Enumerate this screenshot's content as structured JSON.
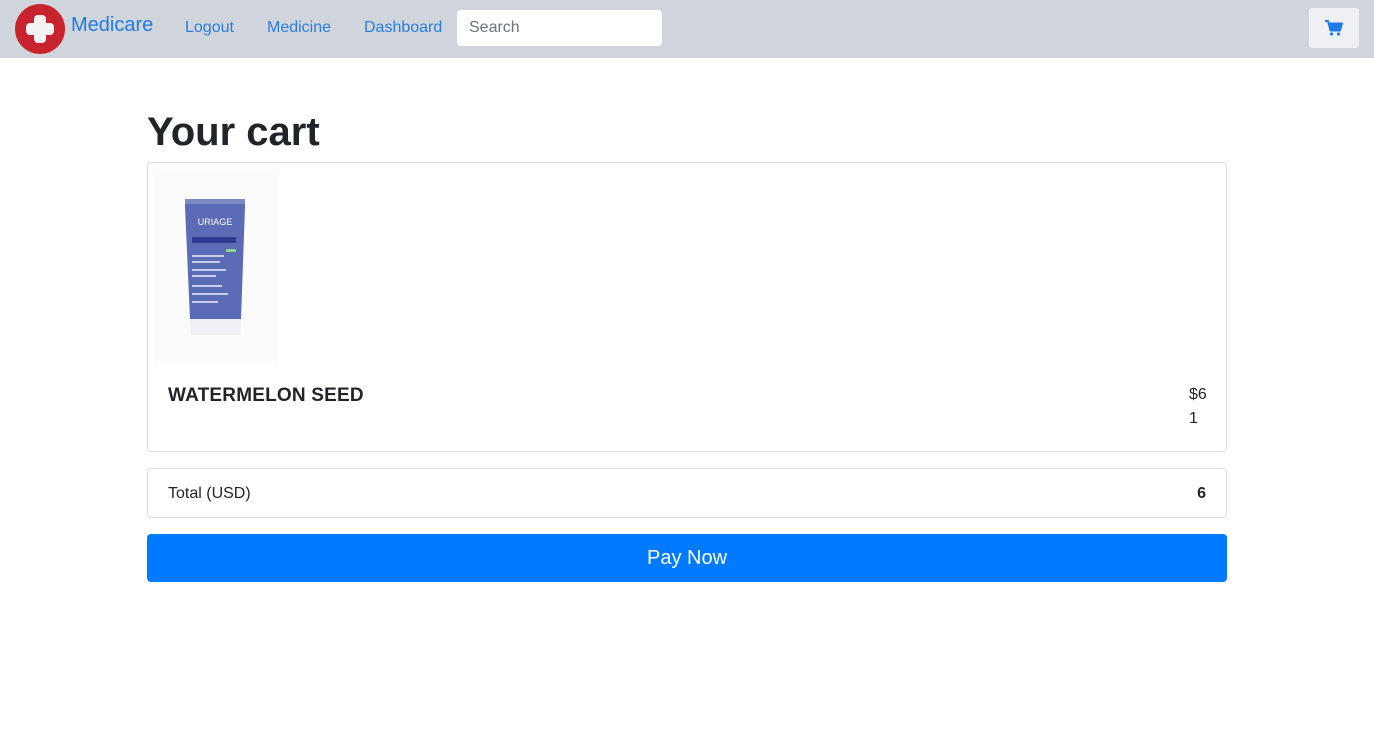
{
  "nav": {
    "brand": "Medicare",
    "links": [
      "Logout",
      "Medicine",
      "Dashboard"
    ],
    "search_placeholder": "Search",
    "cart_icon": "shopping-cart-icon",
    "logo_icon": "medical-cross-icon"
  },
  "page": {
    "title": "Your cart"
  },
  "cart": {
    "items": [
      {
        "name": "WATERMELON SEED",
        "price": "$6",
        "quantity": "1",
        "image_label": "URIAGE"
      }
    ],
    "total_label": "Total (USD)",
    "total_value": "6"
  },
  "actions": {
    "pay_label": "Pay Now"
  },
  "colors": {
    "navbar_bg": "#d0d5dc",
    "brand_red": "#c8242f",
    "link_blue": "#2b7de0",
    "primary_blue": "#007bff"
  }
}
